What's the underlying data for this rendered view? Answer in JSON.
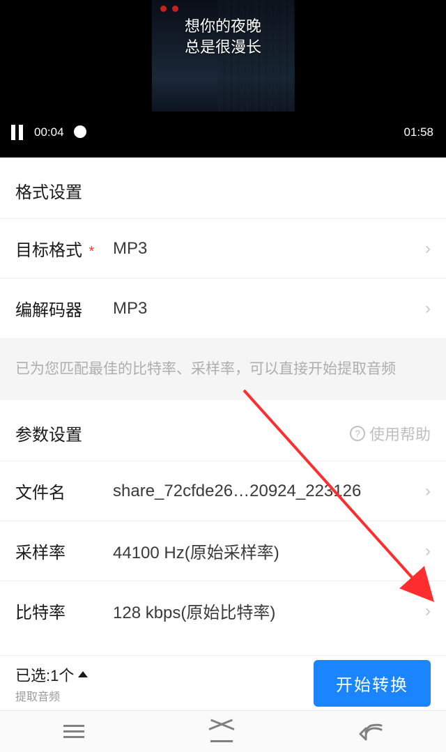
{
  "player": {
    "lyric_line1": "想你的夜晚",
    "lyric_line2": "总是很漫长",
    "current_time": "00:04",
    "duration": "01:58"
  },
  "format_section": {
    "title": "格式设置",
    "rows": {
      "target_format": {
        "label": "目标格式",
        "value": "MP3"
      },
      "codec": {
        "label": "编解码器",
        "value": "MP3"
      }
    }
  },
  "tip": "已为您匹配最佳的比特率、采样率，可以直接开始提取音频",
  "param_section": {
    "title": "参数设置",
    "help_label": "使用帮助",
    "rows": {
      "filename": {
        "label": "文件名",
        "value": "share_72cfde26…20924_223126"
      },
      "sample_rate": {
        "label": "采样率",
        "value": "44100 Hz(原始采样率)"
      },
      "bitrate": {
        "label": "比特率",
        "value": "128 kbps(原始比特率)"
      }
    }
  },
  "footer": {
    "selected_text": "已选:1个",
    "subtitle": "提取音频",
    "primary_button": "开始转换"
  }
}
